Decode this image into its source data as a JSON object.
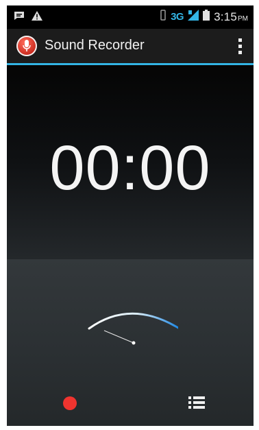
{
  "statusbar": {
    "network": "3G",
    "time": "3:15",
    "ampm": "PM",
    "icons": [
      "message-icon",
      "warning-icon",
      "vibrate-icon",
      "signal-icon",
      "battery-icon"
    ]
  },
  "actionbar": {
    "title": "Sound Recorder",
    "logo_icon": "microphone-icon",
    "menu_icon": "overflow-menu-icon"
  },
  "timer": {
    "value": "00:00"
  },
  "controls": {
    "record_icon": "record-icon",
    "list_icon": "recordings-list-icon"
  },
  "colors": {
    "accent": "#33b5e5",
    "record": "#f0342f",
    "background": "#0a0a0a"
  }
}
